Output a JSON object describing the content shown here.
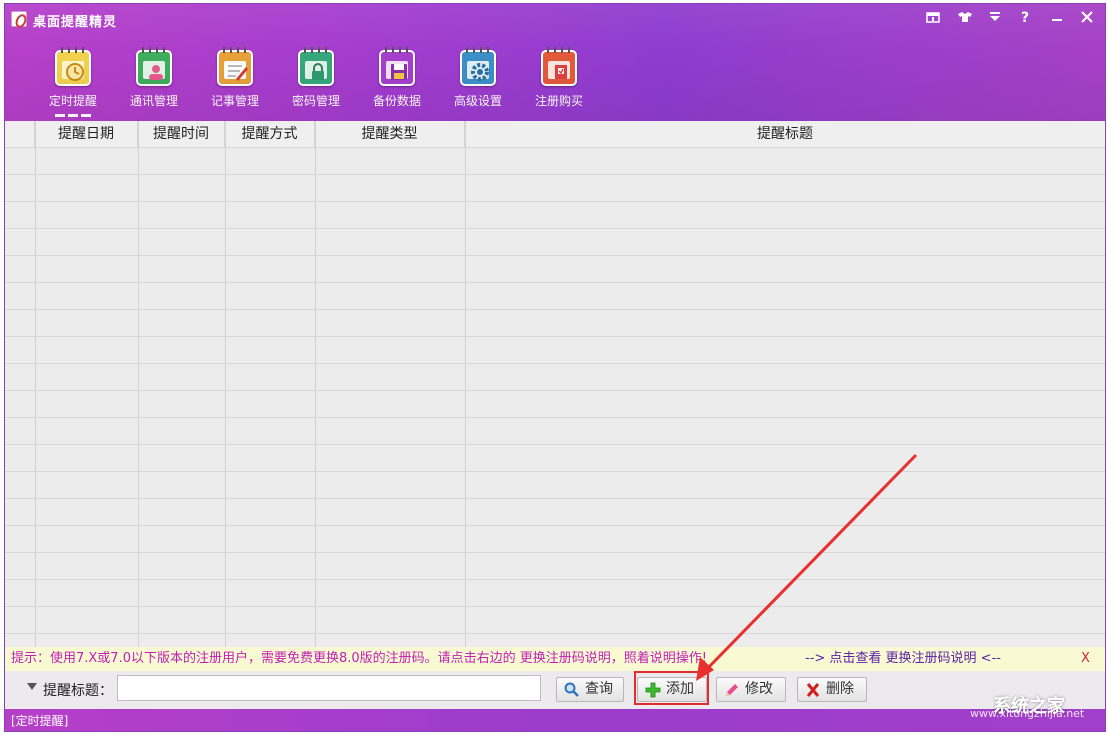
{
  "app": {
    "title": "桌面提醒精灵"
  },
  "toolbar": {
    "items": [
      {
        "label": "定时提醒",
        "icon": "timer-reminder-icon",
        "color": "#f2d24d"
      },
      {
        "label": "通讯管理",
        "icon": "contacts-icon",
        "color": "#3eae5d"
      },
      {
        "label": "记事管理",
        "icon": "notes-icon",
        "color": "#e8a13a"
      },
      {
        "label": "密码管理",
        "icon": "password-lock-icon",
        "color": "#36a77c"
      },
      {
        "label": "备份数据",
        "icon": "backup-disk-icon",
        "color": "#a63fcd"
      },
      {
        "label": "高级设置",
        "icon": "gear-settings-icon",
        "color": "#3b8fc7"
      },
      {
        "label": "注册购买",
        "icon": "register-buy-icon",
        "color": "#e25a3a"
      }
    ]
  },
  "grid": {
    "columns": [
      "提醒日期",
      "提醒时间",
      "提醒方式",
      "提醒类型",
      "提醒标题"
    ],
    "rows": []
  },
  "hint": {
    "text": "提示：使用7.X或7.0以下版本的注册用户，需要免费更换8.0版的注册码。请点击右边的 更换注册码说明，照着说明操作!",
    "link": "--> 点击查看 更换注册码说明 <--",
    "close": "X"
  },
  "search": {
    "label": "提醒标题：",
    "value": "",
    "query_label": "查询",
    "add_label": "添加",
    "edit_label": "修改",
    "delete_label": "删除"
  },
  "status": {
    "text": "[定时提醒]"
  },
  "watermark": {
    "logo": "系统之家",
    "url": "www.xitongzhijia.net"
  },
  "colors": {
    "accent": "#a23ccf",
    "hint_text": "#c01fb5",
    "highlight": "#e02d2d"
  }
}
